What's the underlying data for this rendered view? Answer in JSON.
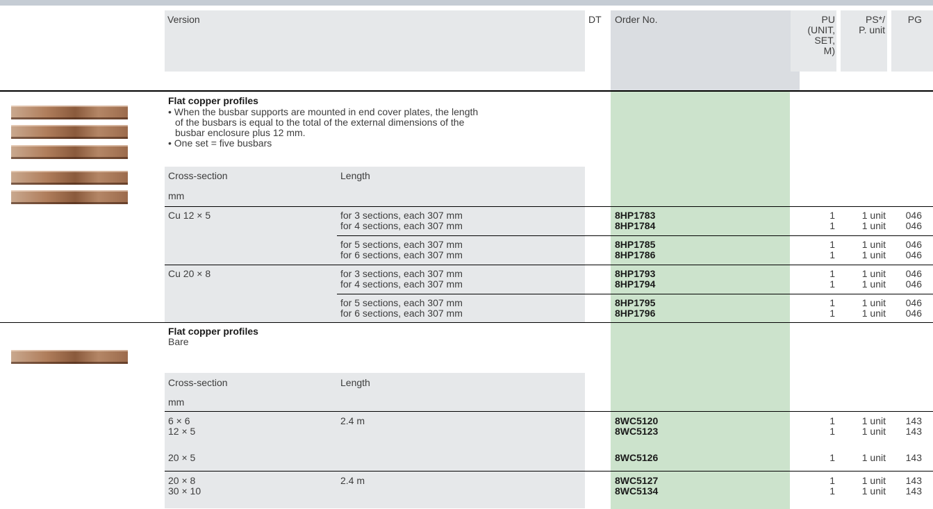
{
  "header": {
    "version": "Version",
    "dt": "DT",
    "order_no": "Order No.",
    "pu": [
      "PU",
      "(UNIT,",
      "SET,",
      "M)"
    ],
    "ps": [
      "PS*/",
      "P. unit"
    ],
    "pg": "PG"
  },
  "section1": {
    "title": "Flat copper profiles",
    "notes": [
      "• When the busbar supports are mounted in end cover plates, the length",
      "of the busbars is equal to the total of the external dimensions of the",
      "busbar enclosure plus 12 mm.",
      "• One set = five busbars"
    ],
    "col_cross": "Cross-section",
    "col_length": "Length",
    "unit": "mm",
    "groups": [
      {
        "cross": "Cu 12 × 5",
        "rows": [
          {
            "length": "for 3 sections, each 307 mm",
            "order": "8HP1783",
            "pu": "1",
            "ps": "1 unit",
            "pg": "046"
          },
          {
            "length": "for 4 sections, each 307 mm",
            "order": "8HP1784",
            "pu": "1",
            "ps": "1 unit",
            "pg": "046"
          },
          {
            "length": "for 5 sections, each 307 mm",
            "order": "8HP1785",
            "pu": "1",
            "ps": "1 unit",
            "pg": "046"
          },
          {
            "length": "for 6 sections, each 307 mm",
            "order": "8HP1786",
            "pu": "1",
            "ps": "1 unit",
            "pg": "046"
          }
        ]
      },
      {
        "cross": "Cu 20 × 8",
        "rows": [
          {
            "length": "for 3 sections, each 307 mm",
            "order": "8HP1793",
            "pu": "1",
            "ps": "1 unit",
            "pg": "046"
          },
          {
            "length": "for 4 sections, each 307 mm",
            "order": "8HP1794",
            "pu": "1",
            "ps": "1 unit",
            "pg": "046"
          },
          {
            "length": "for 5 sections, each 307 mm",
            "order": "8HP1795",
            "pu": "1",
            "ps": "1 unit",
            "pg": "046"
          },
          {
            "length": "for 6 sections, each 307 mm",
            "order": "8HP1796",
            "pu": "1",
            "ps": "1 unit",
            "pg": "046"
          }
        ]
      }
    ]
  },
  "section2": {
    "title": "Flat copper profiles",
    "subtitle": "Bare",
    "col_cross": "Cross-section",
    "col_length": "Length",
    "unit": "mm",
    "rows": [
      {
        "cross": "6 × 6",
        "length": "2.4 m",
        "order": "8WC5120",
        "pu": "1",
        "ps": "1 unit",
        "pg": "143"
      },
      {
        "cross": "12 × 5",
        "length": "",
        "order": "8WC5123",
        "pu": "1",
        "ps": "1 unit",
        "pg": "143"
      },
      {
        "cross": "20 × 5",
        "length": "",
        "order": "8WC5126",
        "pu": "1",
        "ps": "1 unit",
        "pg": "143"
      },
      {
        "cross": "20 × 8",
        "length": "2.4 m",
        "order": "8WC5127",
        "pu": "1",
        "ps": "1 unit",
        "pg": "143"
      },
      {
        "cross": "30 × 10",
        "length": "",
        "order": "8WC5134",
        "pu": "1",
        "ps": "1 unit",
        "pg": "143"
      }
    ]
  }
}
